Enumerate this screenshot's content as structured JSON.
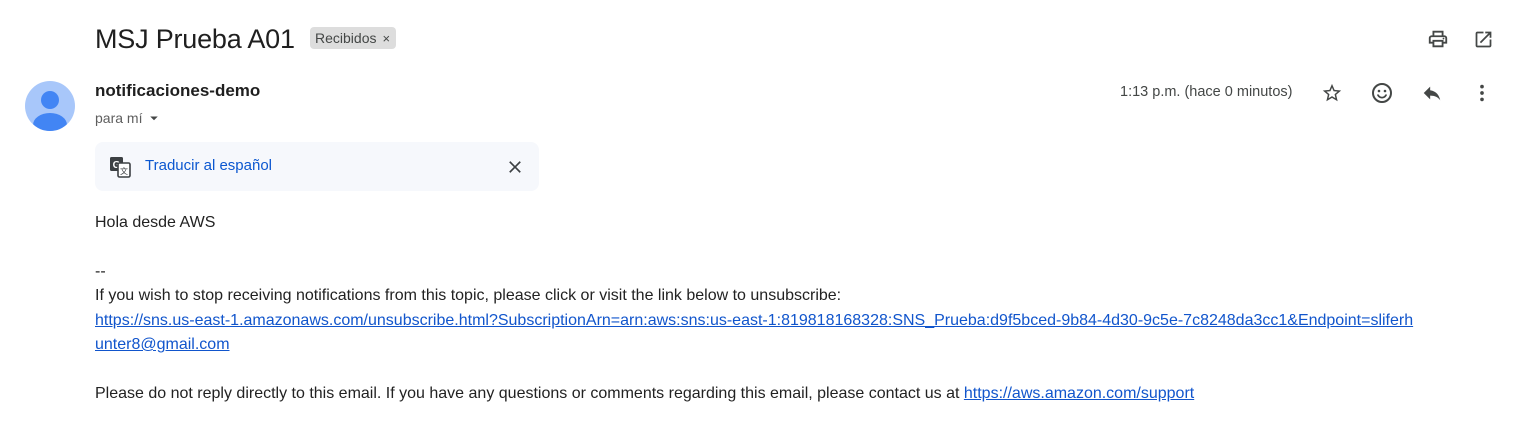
{
  "email": {
    "subject": "MSJ Prueba A01",
    "label": "Recibidos",
    "label_remove": "×",
    "sender_name": "notificaciones-demo",
    "recipient": "para mí",
    "time": "1:13 p.m. (hace 0 minutos)"
  },
  "translate_bar": {
    "link_text": "Traducir al español"
  },
  "body": {
    "greeting": "Hola desde AWS",
    "separator": "--",
    "unsubscribe_notice": "If you wish to stop receiving notifications from this topic, please click or visit the link below to unsubscribe:",
    "unsubscribe_url_line1": "https://sns.us-east-1.amazonaws.com/unsubscribe.html?SubscriptionArn=arn:aws:sns:us-east-1:819818168328:SNS_Prueba:d9f5bced-9b84-4d30-9c5e-7c8248da3cc1&Endpoint=sliferh",
    "unsubscribe_url_line2": "unter8@gmail.com",
    "contact_text": "Please do not reply directly to this email. If you have any questions or comments regarding this email, please contact us at ",
    "support_url": "https://aws.amazon.com/support"
  },
  "icons": {
    "print": "print-icon",
    "open_new_window": "open-in-new-icon",
    "star": "star-icon",
    "emoji": "emoji-icon",
    "reply": "reply-icon",
    "more": "more-vert-icon",
    "translate": "translate-icon",
    "close": "close-icon",
    "dropdown": "arrow-drop-down-icon",
    "avatar": "avatar-icon"
  },
  "colors": {
    "avatar_bg": "#a8c7fa",
    "avatar_fg": "#4285f4",
    "link": "#1155cc",
    "translate_link": "#0b57d0",
    "translate_bar_bg": "#f6f8fc",
    "label_chip_bg": "#dddddd"
  }
}
